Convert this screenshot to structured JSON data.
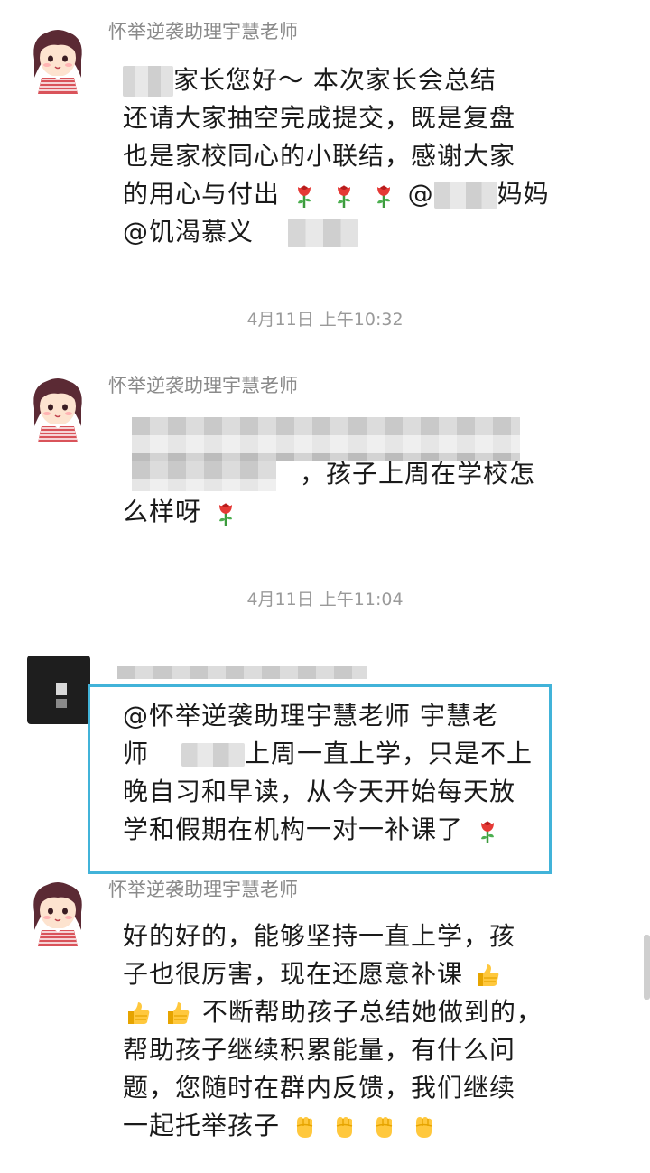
{
  "messages": [
    {
      "sender": "怀举逆袭助理宇慧老师",
      "lines": [
        "家长您好～ 本次家长会总结",
        "还请大家抽空完成提交，既是复盘",
        "也是家校同心的小联结，感谢大家",
        "的用心与付出",
        "@饥渴慕义"
      ],
      "mention_suffix": "妈妈"
    },
    {
      "sender": "怀举逆袭助理宇慧老师",
      "lines": [
        "，孩子上周在学校怎",
        "么样呀"
      ]
    },
    {
      "sender_redacted": true,
      "lines": [
        "@怀举逆袭助理宇慧老师   宇慧老",
        "师",
        "上周一直上学，只是不上",
        "晚自习和早读，从今天开始每天放",
        "学和假期在机构一对一补课了"
      ]
    },
    {
      "sender": "怀举逆袭助理宇慧老师",
      "lines": [
        "好的好的，能够坚持一直上学，孩",
        "子也很厉害，现在还愿意补课",
        "不断帮助孩子总结她做到的，",
        "帮助孩子继续积累能量，有什么问",
        "题，您随时在群内反馈，我们继续",
        "一起托举孩子"
      ]
    }
  ],
  "timestamps": [
    "4月11日 上午10:32",
    "4月11日 上午11:04"
  ],
  "icons": {
    "rose": "rose-icon",
    "thumbs_up": "thumbs-up-icon",
    "raised_fist": "raised-fist-icon",
    "at": "@"
  },
  "colors": {
    "highlight_border": "#41b3d9",
    "sender_gray": "#8a8a8a",
    "timestamp_gray": "#9a9a9a"
  }
}
